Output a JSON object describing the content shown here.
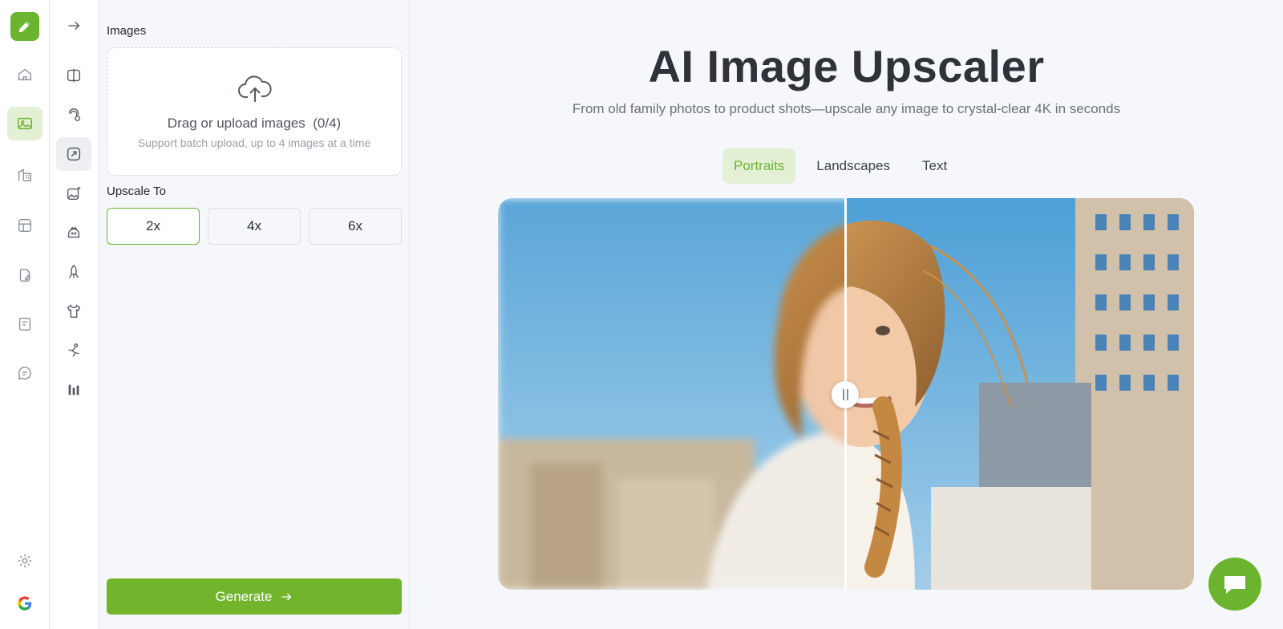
{
  "rail1": {
    "items": [
      {
        "icon": "home-icon"
      },
      {
        "icon": "image-icon",
        "active": true
      },
      {
        "icon": "building-icon"
      },
      {
        "icon": "layout-icon"
      },
      {
        "icon": "file-edit-icon"
      },
      {
        "icon": "note-icon"
      },
      {
        "icon": "chat-icon"
      }
    ],
    "bottom": [
      {
        "icon": "gear-icon"
      },
      {
        "icon": "google-icon"
      }
    ]
  },
  "rail2": {
    "items": [
      {
        "icon": "collapse-arrow-icon"
      },
      {
        "icon": "compare-icon"
      },
      {
        "icon": "face-swap-icon"
      },
      {
        "icon": "upscale-icon",
        "active": true
      },
      {
        "icon": "image-sparkle-icon"
      },
      {
        "icon": "avatar-icon"
      },
      {
        "icon": "rocket-icon"
      },
      {
        "icon": "shirt-icon"
      },
      {
        "icon": "dance-icon"
      },
      {
        "icon": "bars-icon"
      }
    ]
  },
  "panel": {
    "images_label": "Images",
    "upload_title": "Drag or upload images",
    "upload_count": "(0/4)",
    "upload_hint": "Support batch upload, up to 4 images at a time",
    "upscale_label": "Upscale To",
    "scale_options": [
      "2x",
      "4x",
      "6x"
    ],
    "selected_scale": "2x",
    "generate_label": "Generate",
    "accent": "#6cb42f"
  },
  "main": {
    "title": "AI Image Upscaler",
    "subtitle": "From old family photos to product shots—upscale any image to crystal-clear 4K in seconds",
    "tabs": [
      "Portraits",
      "Landscapes",
      "Text"
    ],
    "active_tab": "Portraits"
  }
}
